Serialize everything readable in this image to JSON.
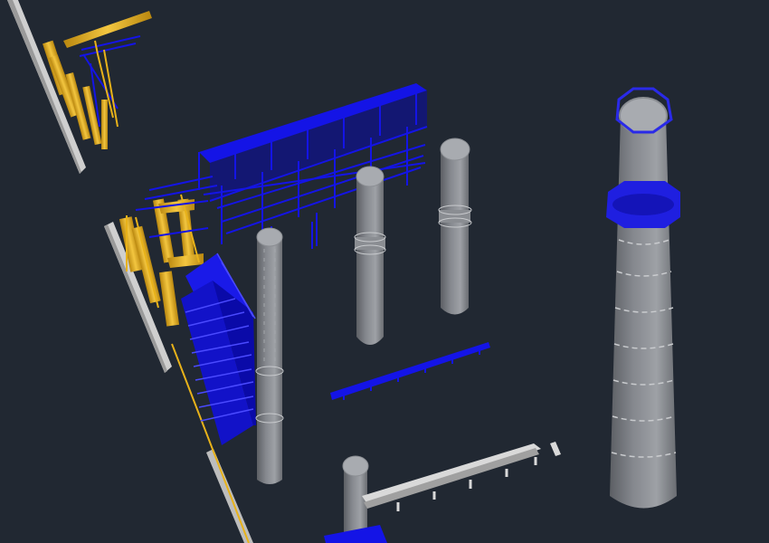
{
  "viewport": {
    "background": "#212832"
  },
  "palette": {
    "pipe_yellow": "#e8b21a",
    "pipe_yellow_dark": "#b9870f",
    "structure_blue": "#1414e6",
    "structure_blue_dark": "#0a0aa8",
    "stack_gray": "#777a80",
    "stack_gray_light": "#9ea1a6",
    "stack_gray_dark": "#5c5f64",
    "rail_white": "#d9d9d9"
  },
  "model": {
    "objects": [
      "pipe-rack-corner",
      "pipe-bundle-left",
      "blue-pipe-bridge",
      "blue-equipment-block",
      "stack-small-front",
      "stack-small-middle",
      "stack-small-back",
      "stack-tall-right",
      "stack-bottom",
      "white-rail",
      "blue-rail"
    ]
  }
}
